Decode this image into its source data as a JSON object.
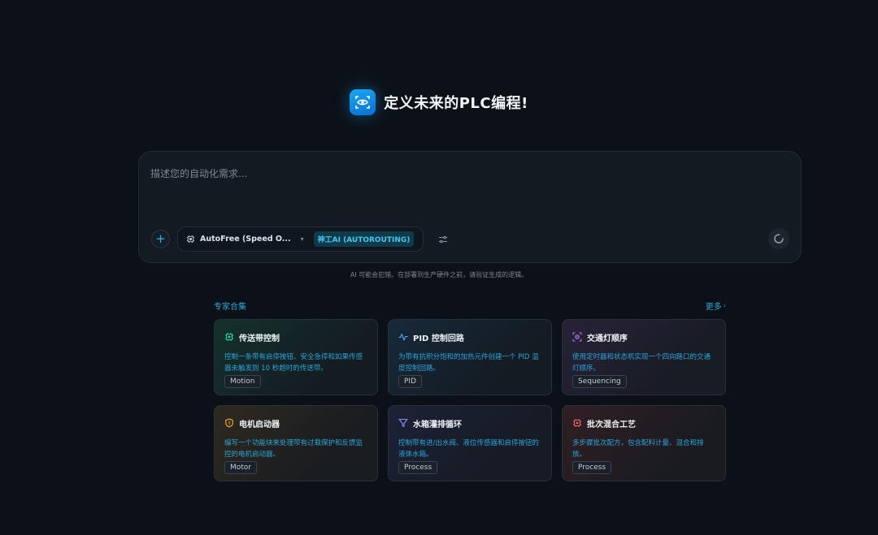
{
  "hero": {
    "title": "定义未来的PLC编程!",
    "logo_icon": "eye-scan-icon"
  },
  "composer": {
    "placeholder": "描述您的自动化需求...",
    "value": "",
    "model_label": "AutoFree (Speed O...",
    "route_badge": "神工AI (AUTOROUTING)"
  },
  "disclaimer": "AI 可能会犯错。在部署到生产硬件之前，请验证生成的逻辑。",
  "section": {
    "title": "专家合集",
    "more_label": "更多"
  },
  "cards": [
    {
      "title": "传送带控制",
      "desc": "控制一条带有启停按钮、安全急停和如果传感器未触发则 10 秒超时的传送带。",
      "tag": "Motion",
      "icon": "cpu-chip-icon",
      "color": "#2bd39a"
    },
    {
      "title": "PID 控制回路",
      "desc": "为带有抗积分饱和的加热元件创建一个 PID 温度控制回路。",
      "tag": "PID",
      "icon": "activity-pulse-icon",
      "color": "#4fa9ff"
    },
    {
      "title": "交通灯顺序",
      "desc": "使用定时器和状态机实现一个四向路口的交通灯顺序。",
      "tag": "Sequencing",
      "icon": "traffic-light-icon",
      "color": "#b07cf5"
    },
    {
      "title": "电机启动器",
      "desc": "编写一个功能块来处理带有过载保护和反馈监控的电机启动器。",
      "tag": "Motor",
      "icon": "shield-icon",
      "color": "#f2b43a"
    },
    {
      "title": "水箱灌排循环",
      "desc": "控制带有进/出水阀、液位传感器和启停按钮的液体水箱。",
      "tag": "Process",
      "icon": "funnel-icon",
      "color": "#8c8ff7"
    },
    {
      "title": "批次混合工艺",
      "desc": "多步骤批次配方，包含配料计量、混合和排放。",
      "tag": "Process",
      "icon": "chip-icon",
      "color": "#f2636b"
    }
  ]
}
